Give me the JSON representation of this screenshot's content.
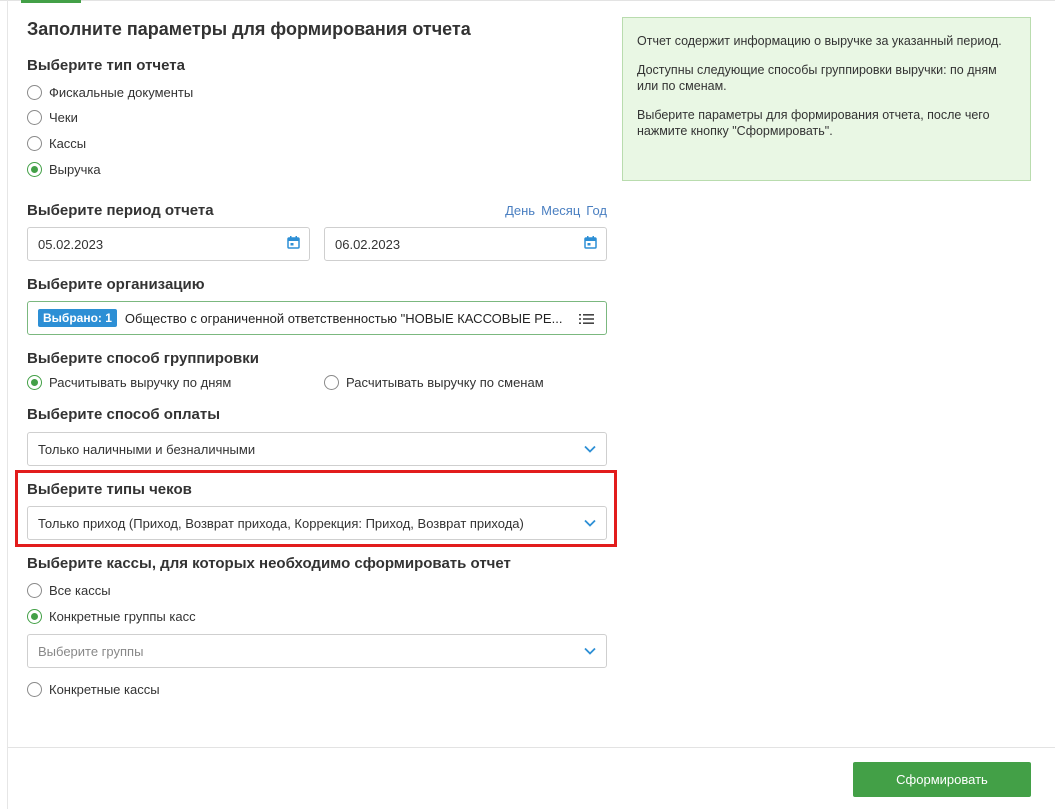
{
  "form": {
    "title": "Заполните параметры для формирования отчета",
    "report_type": {
      "label": "Выберите тип отчета",
      "options": [
        "Фискальные документы",
        "Чеки",
        "Кассы",
        "Выручка"
      ],
      "selected": "Выручка"
    },
    "period": {
      "label": "Выберите период отчета",
      "links": [
        "День",
        "Месяц",
        "Год"
      ],
      "date_from": "05.02.2023",
      "date_to": "06.02.2023"
    },
    "organization": {
      "label": "Выберите организацию",
      "badge": "Выбрано: 1",
      "value": "Общество с ограниченной ответственностью \"НОВЫЕ КАССОВЫЕ РЕ..."
    },
    "grouping": {
      "label": "Выберите способ группировки",
      "options": [
        "Расчитывать выручку по дням",
        "Расчитывать выручку по сменам"
      ],
      "selected": "Расчитывать выручку по дням"
    },
    "payment": {
      "label": "Выберите способ оплаты",
      "value": "Только наличными и безналичными"
    },
    "receipt_types": {
      "label": "Выберите типы чеков",
      "value": "Только приход (Приход, Возврат прихода, Коррекция: Приход, Возврат прихода)"
    },
    "registers": {
      "label": "Выберите кассы, для которых необходимо сформировать отчет",
      "options": [
        "Все кассы",
        "Конкретные группы касс",
        "Конкретные кассы"
      ],
      "selected": "Конкретные группы касс",
      "groups_placeholder": "Выберите группы"
    }
  },
  "info": {
    "paragraphs": [
      "Отчет содержит информацию о выручке за указанный период.",
      "Доступны следующие способы группировки выручки: по дням или по сменам.",
      "Выберите параметры для формирования отчета, после чего нажмите кнопку \"Сформировать\"."
    ]
  },
  "actions": {
    "submit_label": "Сформировать"
  },
  "colors": {
    "accent": "#43a047",
    "link": "#4a7fc1",
    "badge": "#2d8fd5",
    "highlight": "#e21c1c",
    "info_bg": "#e9f7e4"
  }
}
